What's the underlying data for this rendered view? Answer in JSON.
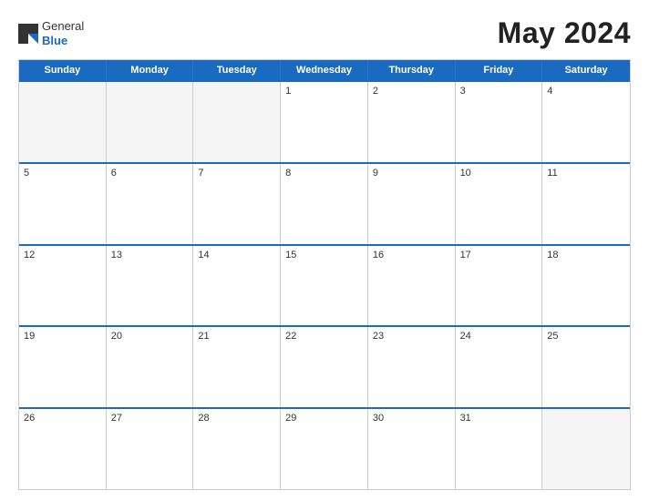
{
  "header": {
    "logo_general": "General",
    "logo_blue": "Blue",
    "title": "May 2024"
  },
  "calendar": {
    "days_of_week": [
      "Sunday",
      "Monday",
      "Tuesday",
      "Wednesday",
      "Thursday",
      "Friday",
      "Saturday"
    ],
    "weeks": [
      [
        {
          "day": "",
          "empty": true
        },
        {
          "day": "",
          "empty": true
        },
        {
          "day": "",
          "empty": true
        },
        {
          "day": "1",
          "empty": false
        },
        {
          "day": "2",
          "empty": false
        },
        {
          "day": "3",
          "empty": false
        },
        {
          "day": "4",
          "empty": false
        }
      ],
      [
        {
          "day": "5",
          "empty": false
        },
        {
          "day": "6",
          "empty": false
        },
        {
          "day": "7",
          "empty": false
        },
        {
          "day": "8",
          "empty": false
        },
        {
          "day": "9",
          "empty": false
        },
        {
          "day": "10",
          "empty": false
        },
        {
          "day": "11",
          "empty": false
        }
      ],
      [
        {
          "day": "12",
          "empty": false
        },
        {
          "day": "13",
          "empty": false
        },
        {
          "day": "14",
          "empty": false
        },
        {
          "day": "15",
          "empty": false
        },
        {
          "day": "16",
          "empty": false
        },
        {
          "day": "17",
          "empty": false
        },
        {
          "day": "18",
          "empty": false
        }
      ],
      [
        {
          "day": "19",
          "empty": false
        },
        {
          "day": "20",
          "empty": false
        },
        {
          "day": "21",
          "empty": false
        },
        {
          "day": "22",
          "empty": false
        },
        {
          "day": "23",
          "empty": false
        },
        {
          "day": "24",
          "empty": false
        },
        {
          "day": "25",
          "empty": false
        }
      ],
      [
        {
          "day": "26",
          "empty": false
        },
        {
          "day": "27",
          "empty": false
        },
        {
          "day": "28",
          "empty": false
        },
        {
          "day": "29",
          "empty": false
        },
        {
          "day": "30",
          "empty": false
        },
        {
          "day": "31",
          "empty": false
        },
        {
          "day": "",
          "empty": true
        }
      ]
    ]
  }
}
